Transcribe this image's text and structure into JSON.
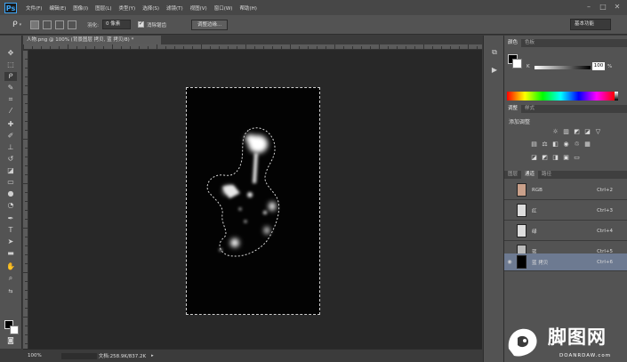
{
  "app": {
    "logo": "Ps"
  },
  "menu": [
    "文件(F)",
    "编辑(E)",
    "图像(I)",
    "图层(L)",
    "类型(Y)",
    "选择(S)",
    "滤镜(T)",
    "视图(V)",
    "窗口(W)",
    "帮助(H)"
  ],
  "window_controls": [
    "minimize-icon",
    "maximize-icon",
    "close-icon"
  ],
  "options": {
    "feather_label": "羽化:",
    "feather_value": "0 像素",
    "antialias_label": "消除锯齿",
    "refine_button": "调整边缘...",
    "workspace": "基本功能"
  },
  "document": {
    "tab_title": "人物.png @ 100% (背景图层 拷贝, 蓝 拷贝/8) *",
    "zoom": "100%",
    "doc_info": "文档:258.9K/837.2K"
  },
  "color_panel": {
    "tabs": [
      "颜色",
      "色板"
    ],
    "channel_label": "K",
    "value": "100",
    "unit": "%"
  },
  "adjustments_panel": {
    "tabs": [
      "调整",
      "样式"
    ],
    "title": "添加调整"
  },
  "channels_panel": {
    "tabs": [
      "图层",
      "通道",
      "路径"
    ],
    "active_tab": "通道",
    "rows": [
      {
        "name": "RGB",
        "shortcut": "Ctrl+2",
        "visible": false,
        "selected": false
      },
      {
        "name": "红",
        "shortcut": "Ctrl+3",
        "visible": false,
        "selected": false
      },
      {
        "name": "绿",
        "shortcut": "Ctrl+4",
        "visible": false,
        "selected": false
      },
      {
        "name": "蓝",
        "shortcut": "Ctrl+5",
        "visible": false,
        "selected": false
      },
      {
        "name": "蓝 拷贝",
        "shortcut": "Ctrl+6",
        "visible": true,
        "selected": true
      }
    ]
  },
  "watermark": {
    "text": "脚图网",
    "sub": "DOANRDAW.com"
  },
  "colors": {
    "ui_dark": "#3b3b3b",
    "ui_mid": "#535353",
    "canvas_bg": "#282828",
    "selection": "#6d7a91",
    "ps_blue": "#3ea5f5"
  }
}
